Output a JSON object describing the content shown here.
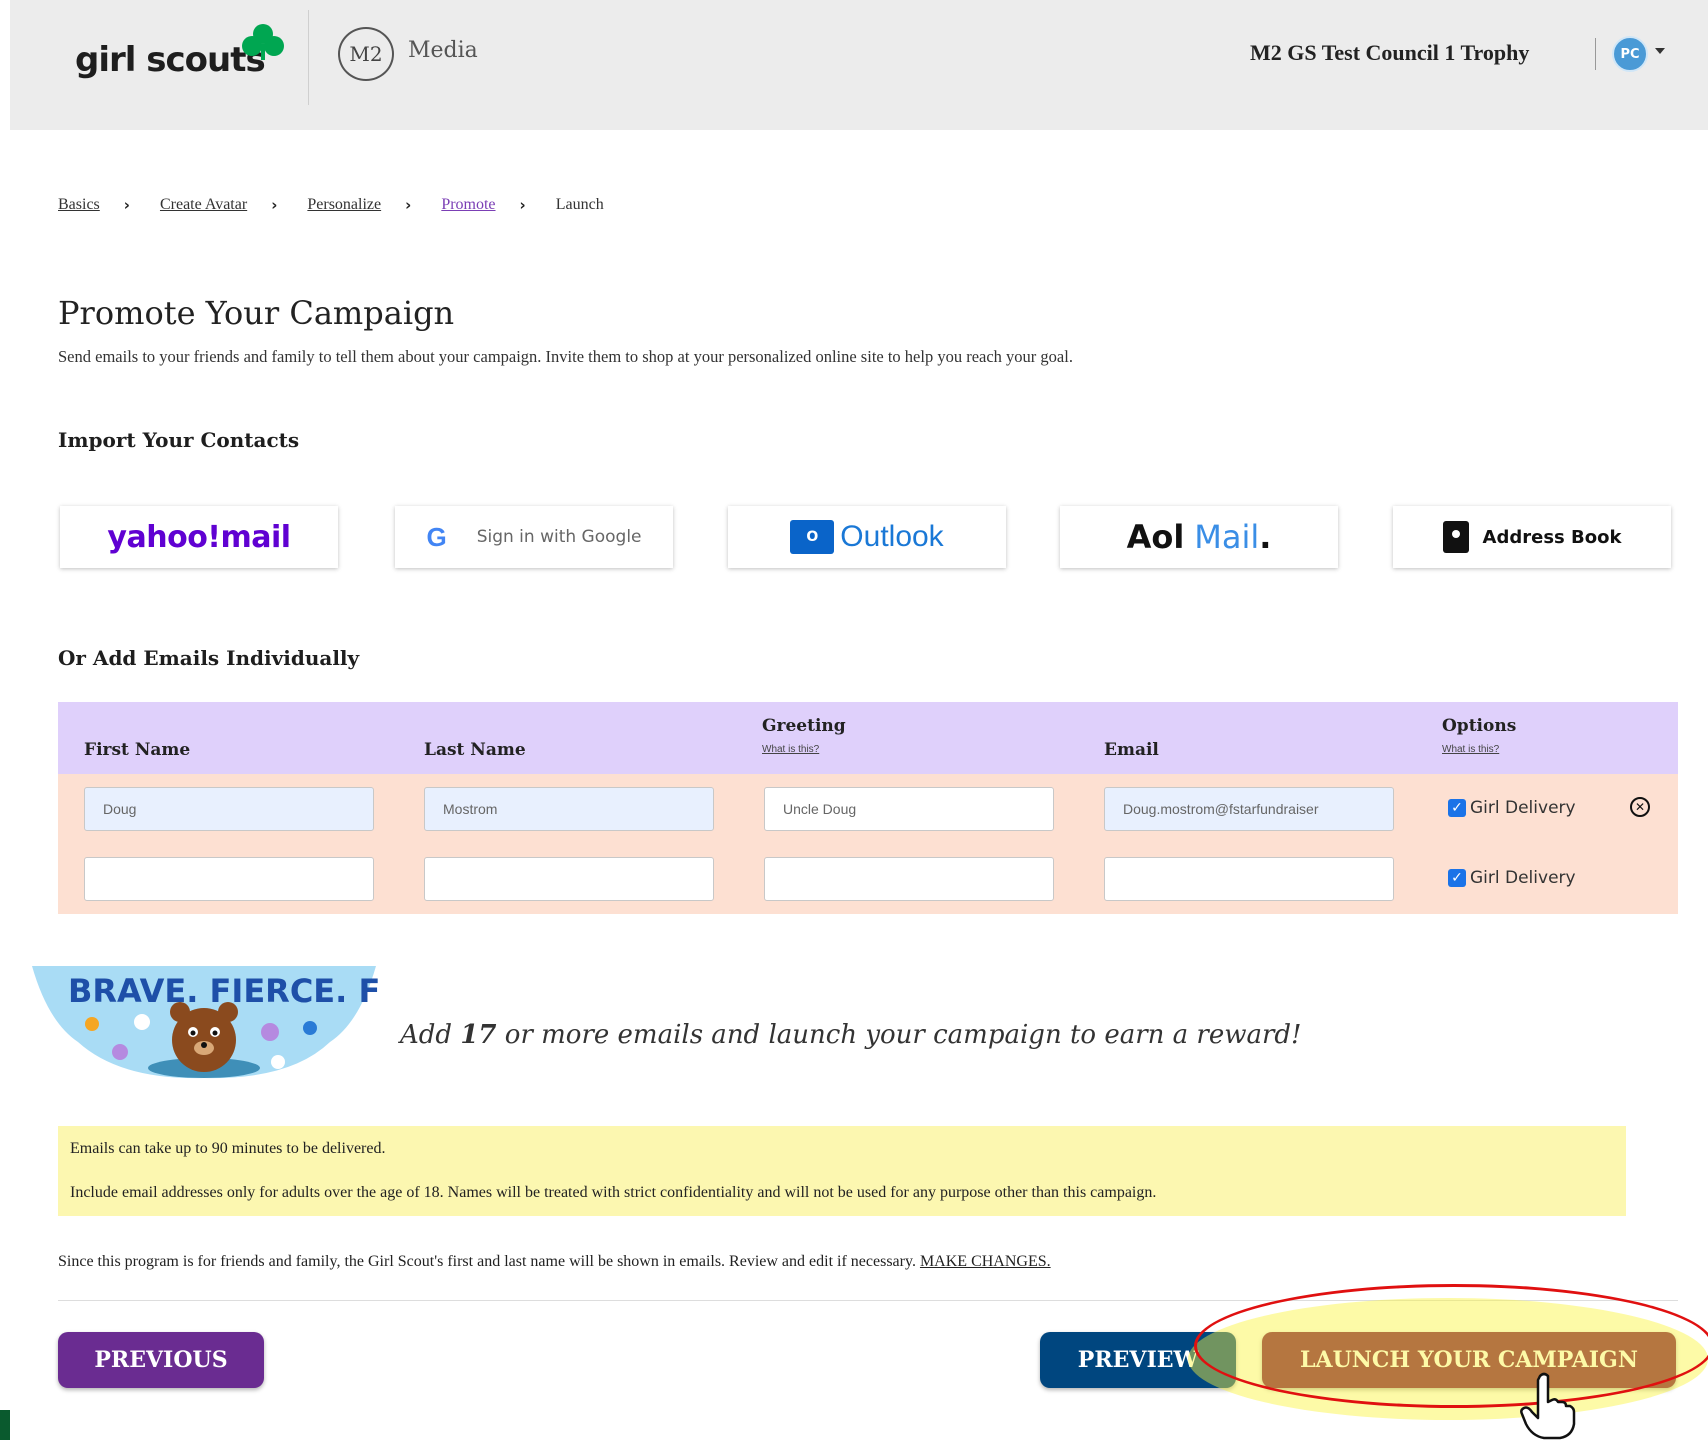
{
  "header": {
    "brand": "girl scouts",
    "m2_initials": "M2",
    "m2_label": "Media",
    "campaign_name": "M2 GS Test Council 1 Trophy",
    "avatar_initials": "PC"
  },
  "breadcrumb": [
    {
      "label": "Basics"
    },
    {
      "label": "Create Avatar"
    },
    {
      "label": "Personalize"
    },
    {
      "label": "Promote"
    },
    {
      "label": "Launch"
    }
  ],
  "page": {
    "title": "Promote Your Campaign",
    "description": "Send emails to your friends and family to tell them about your campaign. Invite them to shop at your personalized online site to help you reach your goal."
  },
  "import": {
    "heading": "Import Your Contacts",
    "yahoo": "yahoo!mail",
    "google_g": "G",
    "google": "Sign in with Google",
    "outlook_badge": "O",
    "outlook": "Outlook",
    "aol": "Aol",
    "aol_mail": "Mail",
    "aol_dot": ".",
    "address_book": "Address Book"
  },
  "individual": {
    "heading": "Or Add Emails Individually",
    "columns": {
      "first_name": "First Name",
      "last_name": "Last Name",
      "greeting": "Greeting",
      "greeting_help": "What is this?",
      "email": "Email",
      "options": "Options",
      "options_help": "What is this?"
    },
    "rows": [
      {
        "first": "Doug",
        "last": "Mostrom",
        "greeting": "Uncle Doug",
        "email": "Doug.mostrom@fstarfundraiser",
        "option": "Girl Delivery"
      },
      {
        "first": "",
        "last": "",
        "greeting": "",
        "email": "",
        "option": "Girl Delivery"
      }
    ]
  },
  "reward": {
    "badge_text": "BRAVE. FIERCE. FUN!",
    "prefix": "Add",
    "count": "17",
    "suffix": "or more emails and launch your campaign to earn a reward!"
  },
  "notice": {
    "line1": "Emails can take up to 90 minutes to be delivered.",
    "line2": "Include email addresses only for adults over the age of 18. Names will be treated with strict confidentiality and will not be used for any purpose other than this campaign."
  },
  "since": {
    "text": "Since this program is for friends and family, the Girl Scout's first and last name will be shown in emails. Review and edit if necessary.",
    "link": "MAKE CHANGES."
  },
  "buttons": {
    "previous": "PREVIOUS",
    "preview": "PREVIEW",
    "launch": "LAUNCH YOUR CAMPAIGN"
  },
  "colors": {
    "header_bg": "#ececec",
    "table_header": "#dfd0fb",
    "table_row": "#fde0d2",
    "notice_bg": "#fcf7b0",
    "previous_btn": "#6a2c91",
    "preview_btn": "#00467f",
    "launch_btn": "#7c0f44"
  }
}
